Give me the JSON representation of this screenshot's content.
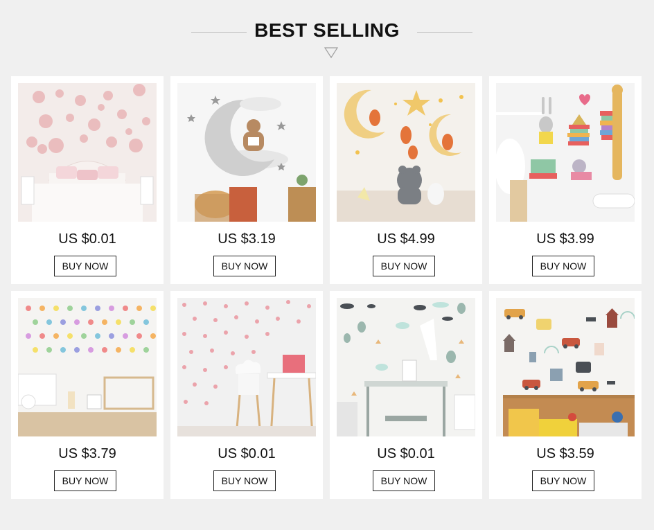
{
  "section": {
    "title": "BEST SELLING"
  },
  "products": [
    {
      "price": "US $0.01",
      "button": "BUY NOW",
      "image_icon": "pink-bubbles-bedroom-image"
    },
    {
      "price": "US $3.19",
      "button": "BUY NOW",
      "image_icon": "bear-on-moon-image"
    },
    {
      "price": "US $4.99",
      "button": "BUY NOW",
      "image_icon": "foxes-moon-stars-image"
    },
    {
      "price": "US $3.99",
      "button": "BUY NOW",
      "image_icon": "bunny-giraffe-books-image"
    },
    {
      "price": "US $3.79",
      "button": "BUY NOW",
      "image_icon": "rainbow-dots-nursery-image"
    },
    {
      "price": "US $0.01",
      "button": "BUY NOW",
      "image_icon": "pink-dots-playroom-image"
    },
    {
      "price": "US $0.01",
      "button": "BUY NOW",
      "image_icon": "balloons-clouds-desk-image"
    },
    {
      "price": "US $3.59",
      "button": "BUY NOW",
      "image_icon": "cars-houses-shelf-image"
    }
  ]
}
